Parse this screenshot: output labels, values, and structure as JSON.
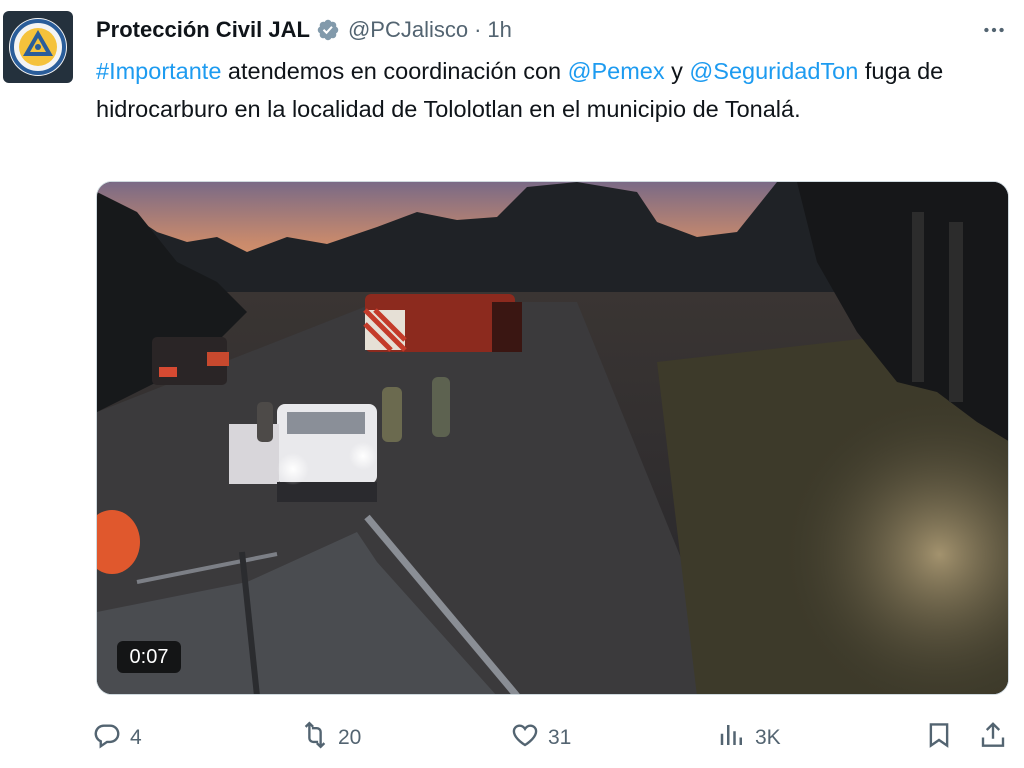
{
  "author": {
    "name": "Protección Civil JAL",
    "handle": "@PCJalisco",
    "separator": "·",
    "time": "1h",
    "verified": true
  },
  "tweet": {
    "hashtag": "#Importante",
    "text_1": " atendemos en coordinación con ",
    "mention_1": "@Pemex",
    "text_2": " y ",
    "mention_2": "@SeguridadTon",
    "text_3": " fuga de hidrocarburo en la localidad de Tololotlan en el municipio de Tonalá."
  },
  "media": {
    "type": "video",
    "duration": "0:07"
  },
  "actions": {
    "replies": "4",
    "reposts": "20",
    "likes": "31",
    "views": "3K"
  },
  "colors": {
    "link": "#1d9bf0",
    "secondary_text": "#536471",
    "verified_badge": "#829aab"
  },
  "icons": [
    "verified-badge-icon",
    "more-icon",
    "reply-icon",
    "repost-icon",
    "like-icon",
    "views-icon",
    "bookmark-icon",
    "share-icon"
  ]
}
